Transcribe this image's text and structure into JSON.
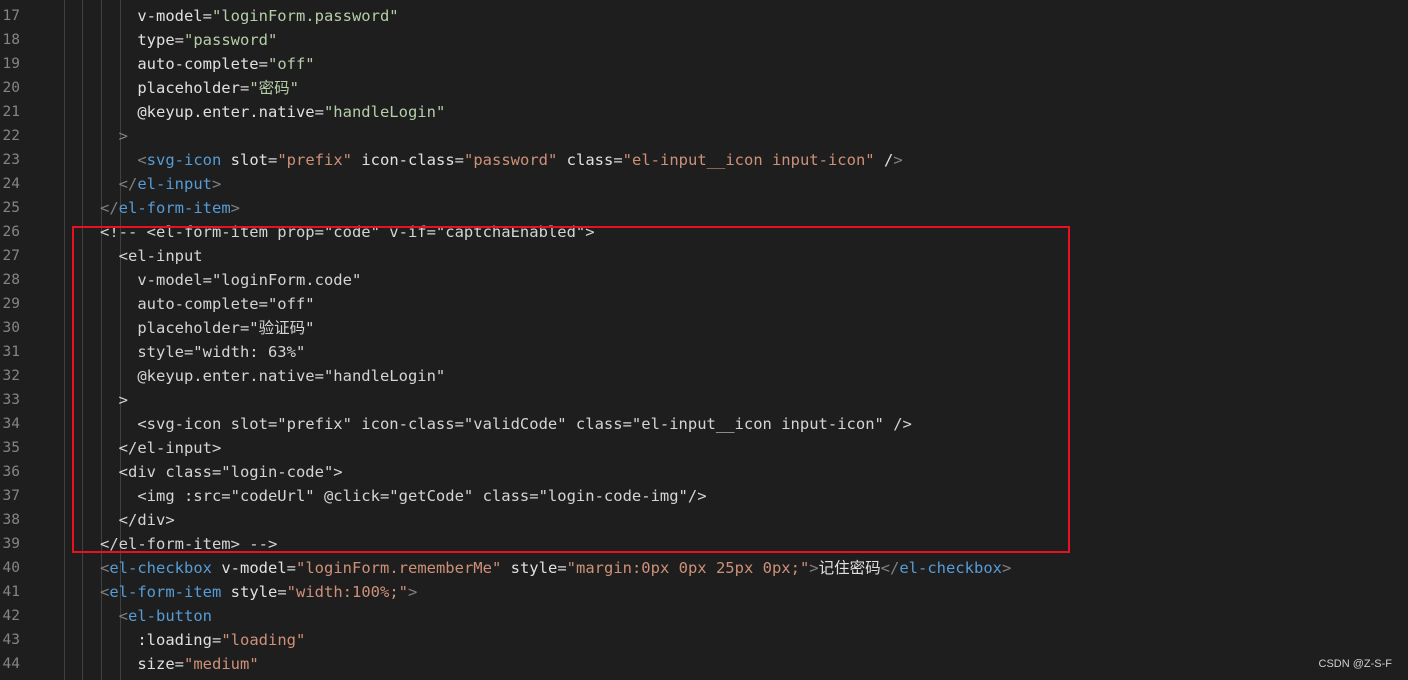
{
  "watermark": "CSDN @Z-S-F",
  "lines": [
    {
      "num": "17",
      "text": "          v-model=\"loginForm.password\""
    },
    {
      "num": "18",
      "text": "          type=\"password\""
    },
    {
      "num": "19",
      "text": "          auto-complete=\"off\""
    },
    {
      "num": "20",
      "text": "          placeholder=\"密码\""
    },
    {
      "num": "21",
      "text": "          @keyup.enter.native=\"handleLogin\""
    },
    {
      "num": "22",
      "text": "        >"
    },
    {
      "num": "23",
      "text": "          <svg-icon slot=\"prefix\" icon-class=\"password\" class=\"el-input__icon input-icon\" />"
    },
    {
      "num": "24",
      "text": "        </el-input>"
    },
    {
      "num": "25",
      "text": "      </el-form-item>"
    },
    {
      "num": "26",
      "text": "      <!-- <el-form-item prop=\"code\" v-if=\"captchaEnabled\">"
    },
    {
      "num": "27",
      "text": "        <el-input"
    },
    {
      "num": "28",
      "text": "          v-model=\"loginForm.code\""
    },
    {
      "num": "29",
      "text": "          auto-complete=\"off\""
    },
    {
      "num": "30",
      "text": "          placeholder=\"验证码\""
    },
    {
      "num": "31",
      "text": "          style=\"width: 63%\""
    },
    {
      "num": "32",
      "text": "          @keyup.enter.native=\"handleLogin\""
    },
    {
      "num": "33",
      "text": "        >"
    },
    {
      "num": "34",
      "text": "          <svg-icon slot=\"prefix\" icon-class=\"validCode\" class=\"el-input__icon input-icon\" />"
    },
    {
      "num": "35",
      "text": "        </el-input>"
    },
    {
      "num": "36",
      "text": "        <div class=\"login-code\">"
    },
    {
      "num": "37",
      "text": "          <img :src=\"codeUrl\" @click=\"getCode\" class=\"login-code-img\"/>"
    },
    {
      "num": "38",
      "text": "        </div>"
    },
    {
      "num": "39",
      "text": "      </el-form-item> -->"
    },
    {
      "num": "40",
      "text": "      <el-checkbox v-model=\"loginForm.rememberMe\" style=\"margin:0px 0px 25px 0px;\">记住密码</el-checkbox>"
    },
    {
      "num": "41",
      "text": "      <el-form-item style=\"width:100%;\">"
    },
    {
      "num": "42",
      "text": "        <el-button"
    },
    {
      "num": "43",
      "text": "          :loading=\"loading\""
    },
    {
      "num": "44",
      "text": "          size=\"medium\""
    }
  ]
}
